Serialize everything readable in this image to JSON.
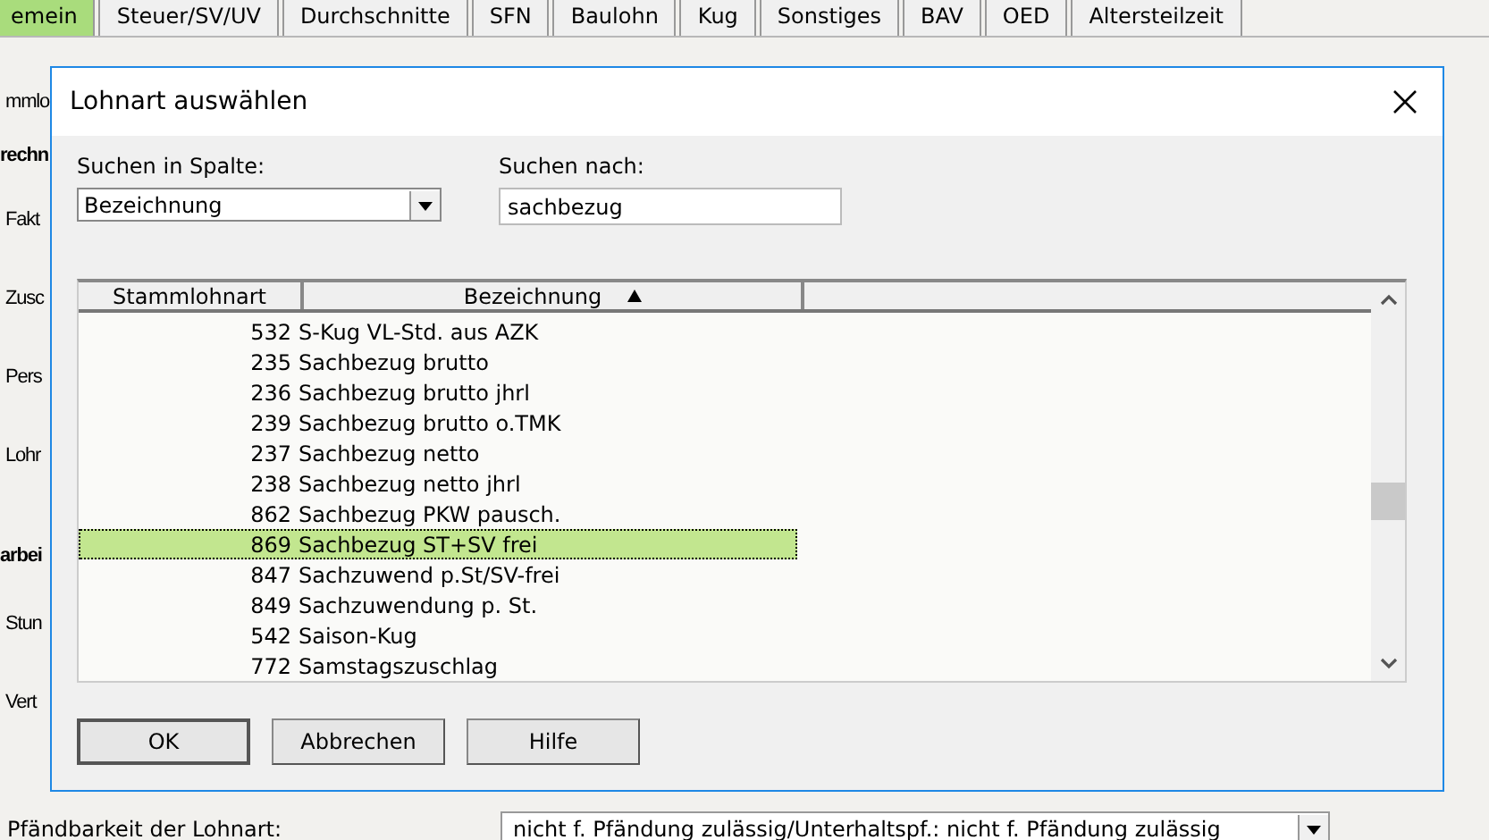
{
  "app": {
    "tabs": [
      {
        "label": "emein",
        "selected": true
      },
      {
        "label": "Steuer/SV/UV",
        "selected": false
      },
      {
        "label": "Durchschnitte",
        "selected": false
      },
      {
        "label": "SFN",
        "selected": false
      },
      {
        "label": "Baulohn",
        "selected": false
      },
      {
        "label": "Kug",
        "selected": false
      },
      {
        "label": "Sonstiges",
        "selected": false
      },
      {
        "label": "BAV",
        "selected": false
      },
      {
        "label": "OED",
        "selected": false
      },
      {
        "label": "Altersteilzeit",
        "selected": false
      }
    ],
    "left_labels": [
      {
        "text": "mmlo",
        "bold": false
      },
      {
        "text": "rechn",
        "bold": true
      },
      {
        "text": "Fakt",
        "bold": false
      },
      {
        "text": "Zusc",
        "bold": false
      },
      {
        "text": "Pers",
        "bold": false
      },
      {
        "text": "Lohr",
        "bold": false
      },
      {
        "text": "arbei",
        "bold": true
      },
      {
        "text": "Stun",
        "bold": false
      },
      {
        "text": "Vert",
        "bold": false
      }
    ],
    "bottom_field": {
      "label": "Pfändbarkeit der Lohnart:",
      "value": "nicht f. Pfändung zulässig/Unterhaltspf.: nicht f. Pfändung zulässig"
    }
  },
  "dialog": {
    "title": "Lohnart auswählen",
    "search_column": {
      "label": "Suchen in Spalte:",
      "value": "Bezeichnung"
    },
    "search_for": {
      "label": "Suchen nach:",
      "value": "sachbezug"
    },
    "table": {
      "columns": [
        {
          "label": "Stammlohnart",
          "sorted": false
        },
        {
          "label": "Bezeichnung",
          "sorted": true
        }
      ],
      "rows": [
        {
          "number": "532",
          "name": "S-Kug VL-Std. aus AZK",
          "selected": false
        },
        {
          "number": "235",
          "name": "Sachbezug brutto",
          "selected": false
        },
        {
          "number": "236",
          "name": "Sachbezug brutto jhrl",
          "selected": false
        },
        {
          "number": "239",
          "name": "Sachbezug brutto o.TMK",
          "selected": false
        },
        {
          "number": "237",
          "name": "Sachbezug netto",
          "selected": false
        },
        {
          "number": "238",
          "name": "Sachbezug netto jhrl",
          "selected": false
        },
        {
          "number": "862",
          "name": "Sachbezug PKW pausch.",
          "selected": false
        },
        {
          "number": "869",
          "name": "Sachbezug ST+SV frei",
          "selected": true
        },
        {
          "number": "847",
          "name": "Sachzuwend p.St/SV-frei",
          "selected": false
        },
        {
          "number": "849",
          "name": "Sachzuwendung p. St.",
          "selected": false
        },
        {
          "number": "542",
          "name": "Saison-Kug",
          "selected": false
        },
        {
          "number": "772",
          "name": "Samstagszuschlag",
          "selected": false
        }
      ]
    },
    "buttons": [
      {
        "label": "OK",
        "default": true
      },
      {
        "label": "Abbrechen",
        "default": false
      },
      {
        "label": "Hilfe",
        "default": false
      }
    ]
  }
}
